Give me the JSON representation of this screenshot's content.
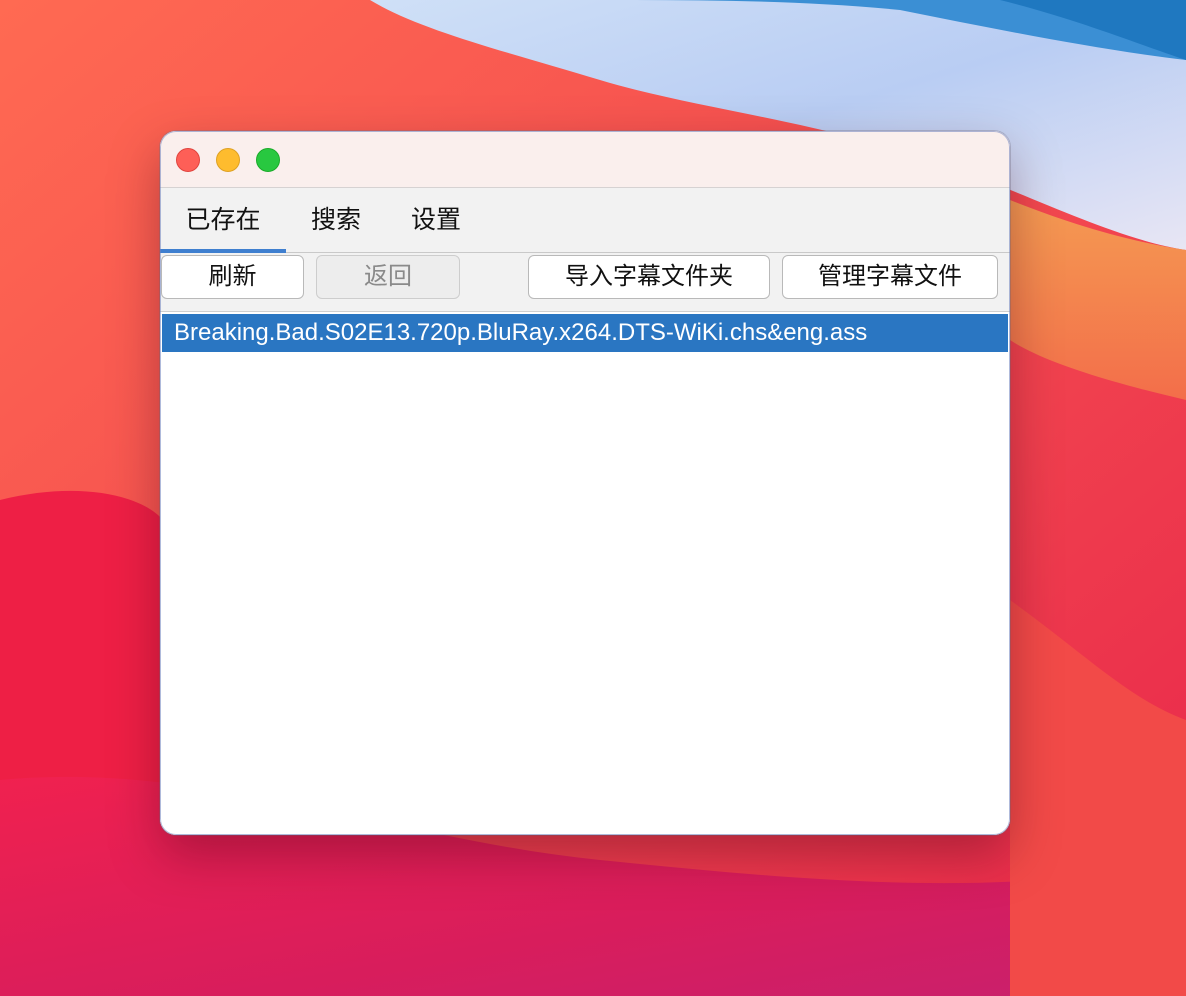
{
  "window": {
    "tabs": [
      {
        "label": "已存在"
      },
      {
        "label": "搜索"
      },
      {
        "label": "设置"
      }
    ],
    "active_tab": 0
  },
  "toolbar": {
    "refresh_label": "刷新",
    "back_label": "返回",
    "import_label": "导入字幕文件夹",
    "manage_label": "管理字幕文件"
  },
  "list": {
    "items": [
      {
        "label": "Breaking.Bad.S02E13.720p.BluRay.x264.DTS-WiKi.chs&eng.ass",
        "selected": true
      }
    ]
  },
  "colors": {
    "selection": "#2a76c2",
    "tab_indicator": "#3f7fcf",
    "close": "#fe5f57",
    "minimize": "#febc2e",
    "zoom": "#28c840"
  }
}
